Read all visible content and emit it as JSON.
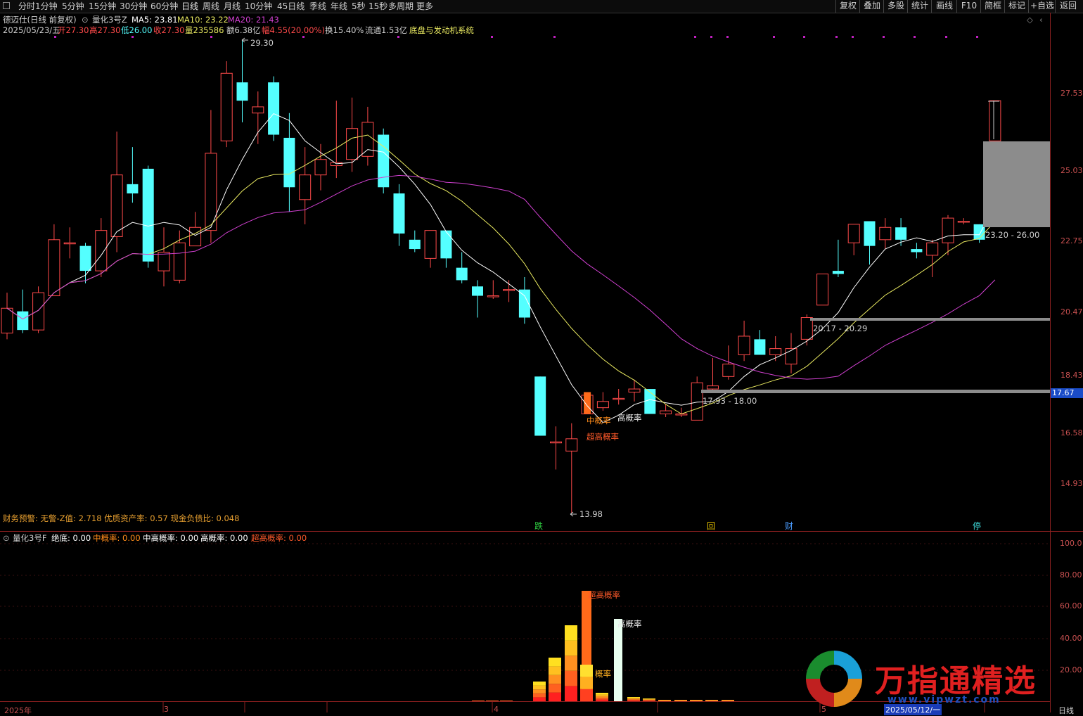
{
  "toolbar": {
    "periods": [
      "分时",
      "1分钟",
      "5分钟",
      "15分钟",
      "30分钟",
      "60分钟",
      "日线",
      "周线",
      "月线",
      "10分钟",
      "45日线",
      "季线",
      "年线",
      "5秒",
      "15秒",
      "多周期",
      "更多"
    ],
    "active": "日线",
    "right": [
      "复权",
      "叠加",
      "多股",
      "统计",
      "画线",
      "F10",
      "简框",
      "标记",
      "+自选",
      "返回"
    ]
  },
  "header": {
    "title": "德迈仕(日线 前复权)",
    "indicator": "量化3号Z",
    "ma5": "MA5: 23.81",
    "ma10": "MA10: 23.22",
    "ma20": "MA20: 21.43",
    "date": "2025/05/23/五",
    "open": "开27.30",
    "high": "高27.30",
    "low": "低26.00",
    "close": "收27.30",
    "vol": "量235586",
    "amount": "额6.38亿",
    "change": "幅4.55(20.00%)",
    "turnover": "换15.40%",
    "float": "流通1.53亿",
    "system": "底盘与发动机系统"
  },
  "price_axis": [
    "27.53",
    "25.03",
    "22.75",
    "20.47",
    "18.43",
    "16.58",
    "14.93"
  ],
  "current_price": "17.67",
  "annotations": {
    "high_point": "29.30",
    "low_point": "13.98",
    "zone_top": "23.20 - 26.00",
    "zone_mid": "20.17 - 20.29",
    "zone_low": "17.93 - 18.00",
    "mid_prob": "中概率",
    "super_prob": "超高概率",
    "high_prob": "高概率"
  },
  "finance": "财务预警: 无警-Z值: 2.718 优质资产率: 0.57 现金负债比: 0.048",
  "event_markers": [
    {
      "label": "跌",
      "color": "#2ecc40"
    },
    {
      "label": "回",
      "color": "#e6c200"
    },
    {
      "label": "财",
      "color": "#4a9cff"
    },
    {
      "label": "停",
      "color": "#40e0e0"
    }
  ],
  "sub_header": {
    "name": "量化3号F",
    "base": "绝底: 0.00",
    "mid": "中概率: 0.00",
    "midhigh": "中高概率: 0.00",
    "high": "高概率: 0.00",
    "super": "超高概率: 0.00"
  },
  "sub_axis": [
    "100.0",
    "80.00",
    "60.00",
    "40.00",
    "20.00"
  ],
  "sub_labels": {
    "super": "超高概率",
    "high": "高概率",
    "mid": "概率"
  },
  "bottom_axis": {
    "year": "2025年",
    "m3": "3",
    "m4": "4",
    "m5": "5",
    "date": "2025/05/12/一",
    "period": "日线"
  },
  "watermark": {
    "text": "万指通精选",
    "url": "www.vipwzt.com"
  },
  "colors": {
    "up": "#ff4a4a",
    "down": "#54ffff",
    "ma5": "#ffffff",
    "ma10": "#e8e860",
    "ma20": "#d040d0",
    "gray": "#8c8c8c"
  },
  "chart_data": {
    "type": "candlestick",
    "title": "",
    "ylim": [
      13.5,
      30.0
    ],
    "candles": [
      [
        19.8,
        20.6,
        21.1,
        19.6
      ],
      [
        20.5,
        19.9,
        21.2,
        19.8
      ],
      [
        19.9,
        21.1,
        21.3,
        19.8
      ],
      [
        21.0,
        22.8,
        23.3,
        21.0
      ],
      [
        22.7,
        22.7,
        23.2,
        22.2
      ],
      [
        22.6,
        21.8,
        22.7,
        21.4
      ],
      [
        21.8,
        23.1,
        23.5,
        21.6
      ],
      [
        22.9,
        24.9,
        26.3,
        22.4
      ],
      [
        24.6,
        24.3,
        25.8,
        24.0
      ],
      [
        25.1,
        22.1,
        25.2,
        21.9
      ],
      [
        21.8,
        22.4,
        23.2,
        21.3
      ],
      [
        21.5,
        22.7,
        23.1,
        21.4
      ],
      [
        22.6,
        23.2,
        23.7,
        22.7
      ],
      [
        23.1,
        25.6,
        27.0,
        22.7
      ],
      [
        26.0,
        28.2,
        28.6,
        25.8
      ],
      [
        27.9,
        27.3,
        29.3,
        26.6
      ],
      [
        26.9,
        27.1,
        27.6,
        25.9
      ],
      [
        27.9,
        26.2,
        28.1,
        26.0
      ],
      [
        26.1,
        24.5,
        26.9,
        23.7
      ],
      [
        24.1,
        24.9,
        25.8,
        23.3
      ],
      [
        24.9,
        25.4,
        25.9,
        24.4
      ],
      [
        25.2,
        25.3,
        27.3,
        24.8
      ],
      [
        25.4,
        26.4,
        27.4,
        25.0
      ],
      [
        25.5,
        26.6,
        27.1,
        25.2
      ],
      [
        26.2,
        24.5,
        26.4,
        24.3
      ],
      [
        24.3,
        23.0,
        24.6,
        22.6
      ],
      [
        22.8,
        22.5,
        23.1,
        22.4
      ],
      [
        22.2,
        23.1,
        23.1,
        21.9
      ],
      [
        23.1,
        22.2,
        23.0,
        21.9
      ],
      [
        21.9,
        21.5,
        22.4,
        21.4
      ],
      [
        21.3,
        21.0,
        21.5,
        20.3
      ],
      [
        21.0,
        21.0,
        21.5,
        20.9
      ],
      [
        21.2,
        21.2,
        21.5,
        20.8
      ],
      [
        21.2,
        20.3,
        21.6,
        20.1
      ],
      [
        18.4,
        16.5,
        18.4,
        16.5
      ],
      [
        16.3,
        16.3,
        16.8,
        15.4
      ],
      [
        16.0,
        16.4,
        16.9,
        14.0
      ],
      [
        17.2,
        17.8,
        17.9,
        17.2
      ],
      [
        17.4,
        17.6,
        17.9,
        17.3
      ],
      [
        17.7,
        17.7,
        18.0,
        17.5
      ],
      [
        17.9,
        18.0,
        18.3,
        17.6
      ],
      [
        18.0,
        17.2,
        18.0,
        17.2
      ],
      [
        17.2,
        17.3,
        17.5,
        17.1
      ],
      [
        17.2,
        17.2,
        17.4,
        17.1
      ],
      [
        17.0,
        18.2,
        18.4,
        17.0
      ],
      [
        18.0,
        18.1,
        19.0,
        17.9
      ],
      [
        18.4,
        18.8,
        19.4,
        18.3
      ],
      [
        19.1,
        19.7,
        20.2,
        18.9
      ],
      [
        19.6,
        19.1,
        19.9,
        19.4
      ],
      [
        19.1,
        19.3,
        19.7,
        18.9
      ],
      [
        18.8,
        19.3,
        19.8,
        18.5
      ],
      [
        19.6,
        20.3,
        20.4,
        19.4
      ],
      [
        20.7,
        21.7,
        21.7,
        20.7
      ],
      [
        21.8,
        21.7,
        22.8,
        21.6
      ],
      [
        22.7,
        23.3,
        23.3,
        22.3
      ],
      [
        23.4,
        22.6,
        23.4,
        22.0
      ],
      [
        22.8,
        23.2,
        23.5,
        22.5
      ],
      [
        23.2,
        22.8,
        23.5,
        22.6
      ],
      [
        22.5,
        22.4,
        22.7,
        22.2
      ],
      [
        22.3,
        22.7,
        22.8,
        21.6
      ],
      [
        22.7,
        23.5,
        23.6,
        22.3
      ],
      [
        23.4,
        23.4,
        23.3,
        23.5
      ],
      [
        23.3,
        22.8,
        23.3,
        22.7
      ],
      [
        26.0,
        27.3,
        27.3,
        26.0
      ]
    ],
    "sub_series": {
      "categories_index": [
        34,
        35,
        36,
        37,
        38,
        39,
        40,
        41
      ],
      "super": [
        14,
        36,
        24,
        70,
        8,
        3,
        2,
        1
      ],
      "high": [
        0,
        0,
        0,
        0,
        0,
        52,
        0,
        0
      ]
    }
  }
}
